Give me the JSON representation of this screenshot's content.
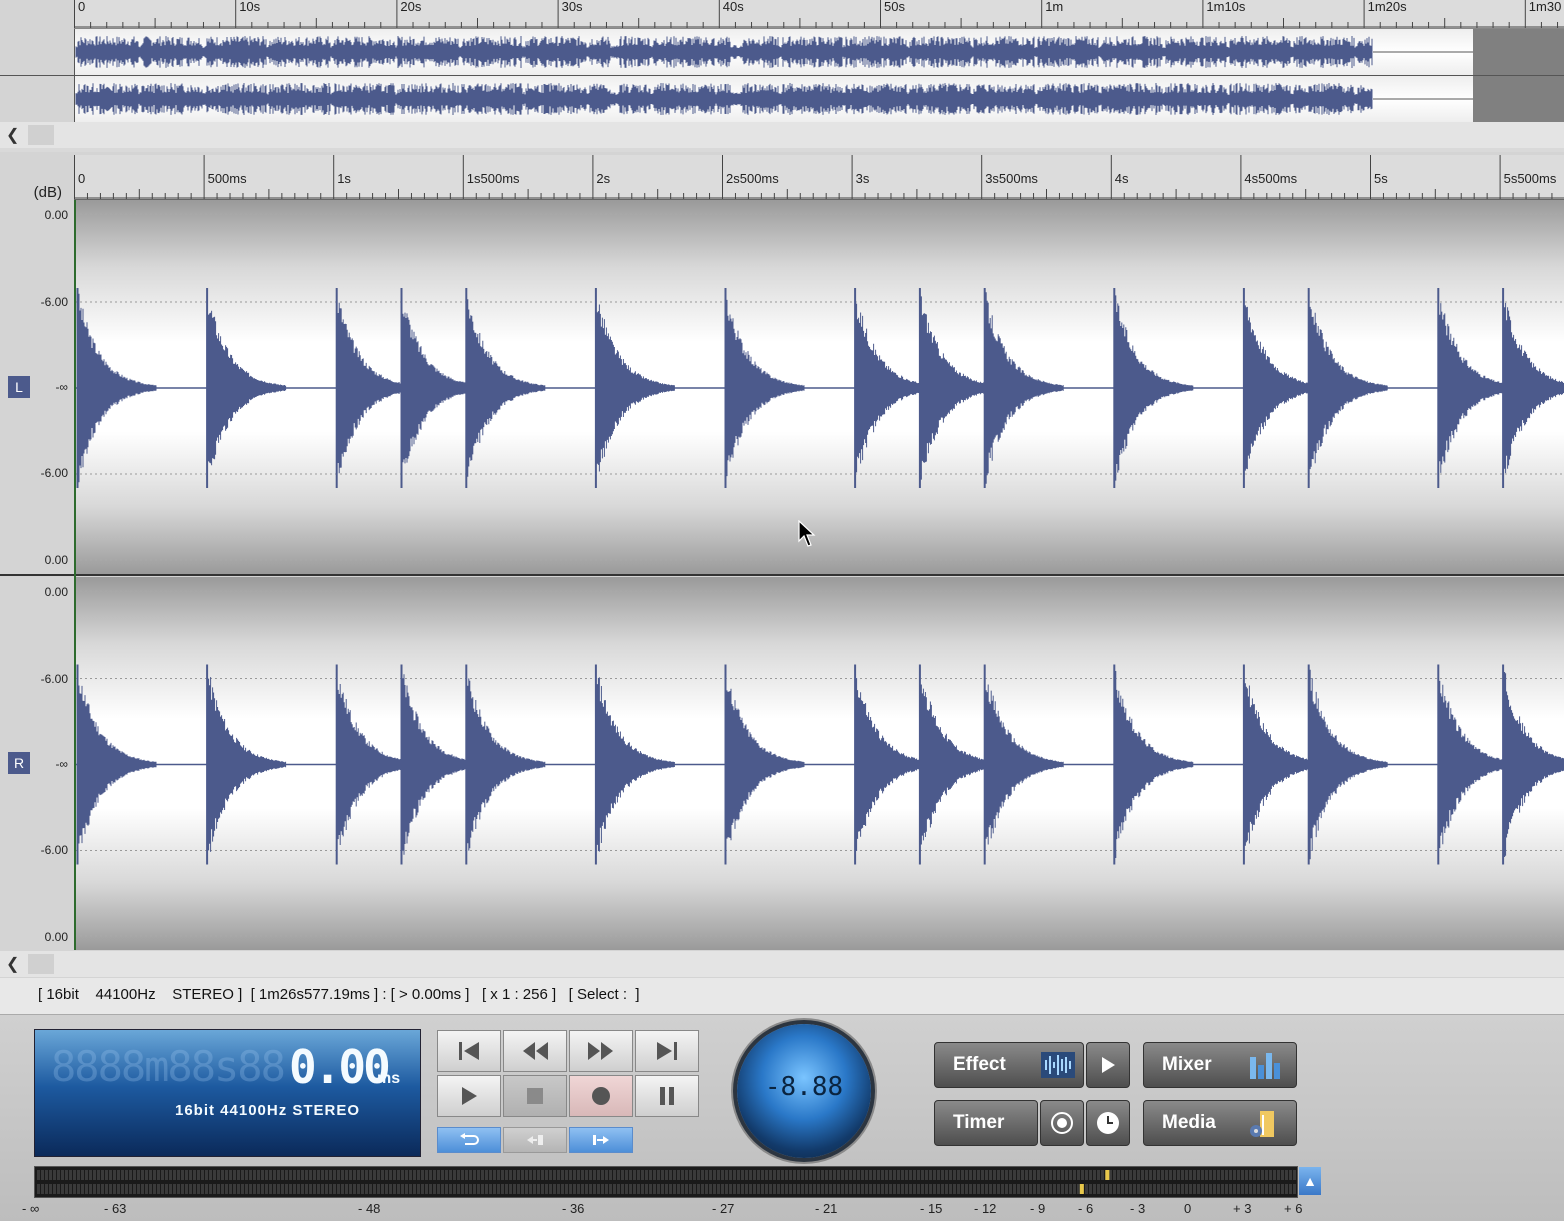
{
  "overview": {
    "ruler_labels": [
      "0",
      "10s",
      "20s",
      "30s",
      "40s",
      "50s",
      "1m",
      "1m10s",
      "1m20s",
      "1m30"
    ]
  },
  "main": {
    "ruler_labels": [
      "0",
      "500ms",
      "1s",
      "1s500ms",
      "2s",
      "2s500ms",
      "3s",
      "3s500ms",
      "4s",
      "4s500ms",
      "5s",
      "5s500ms"
    ],
    "db_unit": "(dB)",
    "channels": [
      {
        "tag": "L",
        "db_labels": [
          "0.00",
          "-6.00",
          "-∞",
          "-6.00",
          "0.00"
        ]
      },
      {
        "tag": "R",
        "db_labels": [
          "0.00",
          "-6.00",
          "-∞",
          "-6.00",
          "0.00"
        ]
      }
    ],
    "transient_positions_ms": [
      0,
      500,
      1000,
      1250,
      1500,
      2000,
      2500,
      3000,
      3250,
      3500,
      4000,
      4500,
      4750,
      5250,
      5500
    ]
  },
  "status": {
    "text": "[ 16bit    44100Hz    STEREO ]  [ 1m26s577.19ms ] : [ > 0.00ms ]   [ x 1 : 256 ]   [ Select :  ]"
  },
  "lcd": {
    "ghost": "8888m88s88",
    "time": "0.00",
    "unit": "ms",
    "format": "16bit   44100Hz STEREO"
  },
  "knob": {
    "display": "-8.88"
  },
  "buttons": {
    "effect": "Effect",
    "mixer": "Mixer",
    "timer": "Timer",
    "media": "Media"
  },
  "meter": {
    "scale": [
      "- ∞",
      "- 63",
      "- 48",
      "- 36",
      "- 27",
      "- 21",
      "- 15",
      "- 12",
      "- 9",
      "- 6",
      "- 3",
      "0",
      "+ 3",
      "+ 6"
    ],
    "peak_db": -5,
    "level_db": -6.5
  },
  "colors": {
    "waveform": "#4c5a8c",
    "lcd_text": "#f4fbff",
    "meter_marker": "#e8c84a"
  }
}
